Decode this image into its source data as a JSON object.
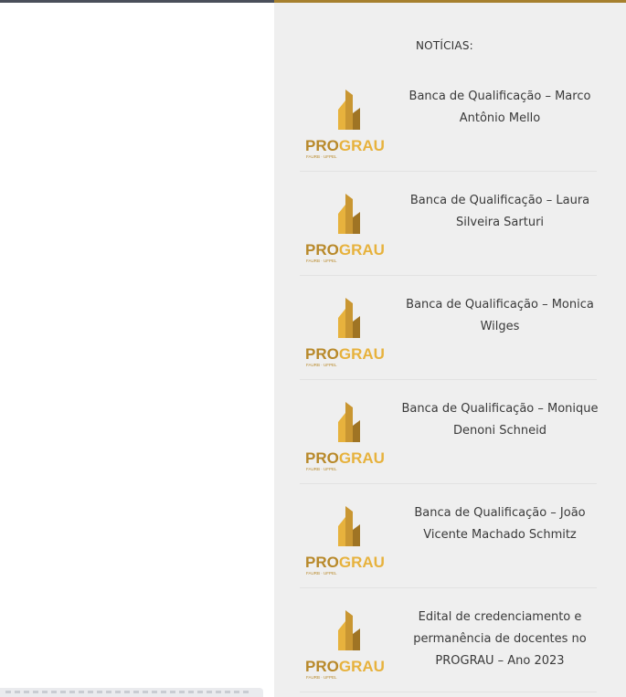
{
  "sidebar": {
    "heading": "NOTÍCIAS:",
    "logo_text": {
      "pro": "PRO",
      "grau": "GRAU",
      "sub": "FAURB · UFPEL"
    },
    "items": [
      {
        "title": "Banca de Qualificação – Marco Antônio Mello"
      },
      {
        "title": "Banca de Qualificação – Laura Silveira Sarturi"
      },
      {
        "title": "Banca de Qualificação – Monica Wilges"
      },
      {
        "title": "Banca de Qualificação – Monique Denoni Schneid"
      },
      {
        "title": "Banca de Qualificação – João Vicente Machado Schmitz"
      },
      {
        "title": "Edital de credenciamento e permanência de docentes no PROGRAU – Ano 2023"
      }
    ]
  },
  "colors": {
    "accent": "#a6802e",
    "gold_light": "#e7b23d",
    "gold_dark": "#b98a2a",
    "text": "#3a3a3a",
    "sidebar_bg": "#efefef"
  }
}
